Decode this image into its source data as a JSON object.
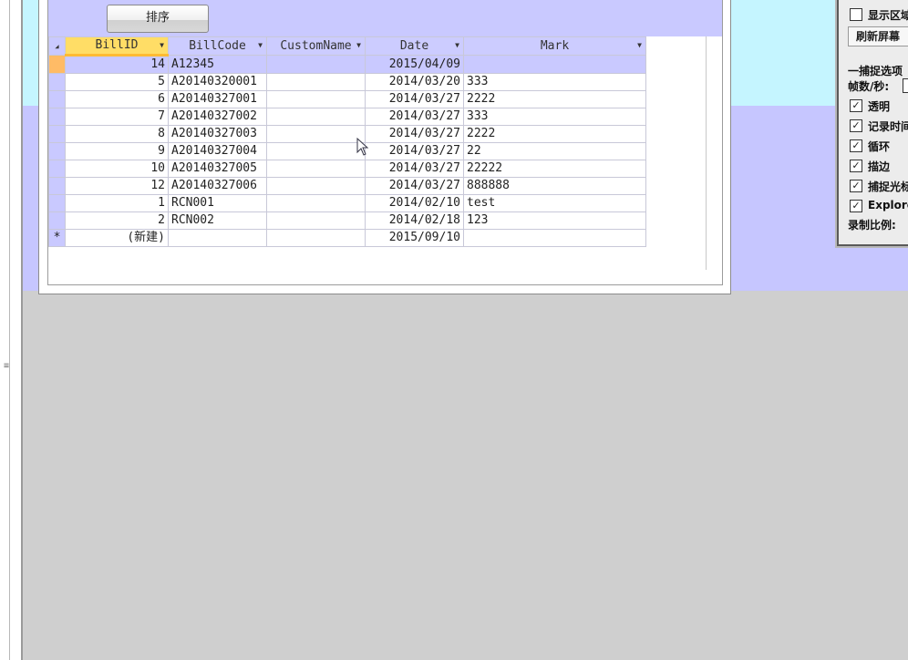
{
  "form": {
    "sort_button": "排序"
  },
  "grid": {
    "columns": [
      "BillID",
      "BillCode",
      "CustomName",
      "Date",
      "Mark"
    ],
    "rows": [
      {
        "BillID": "14",
        "BillCode": "A12345",
        "CustomName": "",
        "Date": "2015/04/09",
        "Mark": ""
      },
      {
        "BillID": "5",
        "BillCode": "A20140320001",
        "CustomName": "",
        "Date": "2014/03/20",
        "Mark": "333"
      },
      {
        "BillID": "6",
        "BillCode": "A20140327001",
        "CustomName": "",
        "Date": "2014/03/27",
        "Mark": "2222"
      },
      {
        "BillID": "7",
        "BillCode": "A20140327002",
        "CustomName": "",
        "Date": "2014/03/27",
        "Mark": "333"
      },
      {
        "BillID": "8",
        "BillCode": "A20140327003",
        "CustomName": "",
        "Date": "2014/03/27",
        "Mark": "2222"
      },
      {
        "BillID": "9",
        "BillCode": "A20140327004",
        "CustomName": "",
        "Date": "2014/03/27",
        "Mark": "22"
      },
      {
        "BillID": "10",
        "BillCode": "A20140327005",
        "CustomName": "",
        "Date": "2014/03/27",
        "Mark": "22222"
      },
      {
        "BillID": "12",
        "BillCode": "A20140327006",
        "CustomName": "",
        "Date": "2014/03/27",
        "Mark": "888888"
      },
      {
        "BillID": "1",
        "BillCode": "RCN001",
        "CustomName": "",
        "Date": "2014/02/10",
        "Mark": "test"
      },
      {
        "BillID": "2",
        "BillCode": "RCN002",
        "CustomName": "",
        "Date": "2014/02/18",
        "Mark": "123"
      }
    ],
    "new_row": {
      "marker": "*",
      "BillID": "(新建)",
      "Date": "2015/09/10"
    },
    "current_row_index": 0
  },
  "side_panel": {
    "show_region": "显示区域",
    "refresh_screen": "刷新屏幕",
    "capture_options": "一捕捉选项",
    "fps_label": "帧数/秒:",
    "checkboxes": [
      {
        "label": "透明",
        "checked": true
      },
      {
        "label": "记录时间",
        "checked": true
      },
      {
        "label": "循环",
        "checked": true
      },
      {
        "label": "描边",
        "checked": true
      },
      {
        "label": "捕捉光标",
        "checked": true
      },
      {
        "label": "Explorer",
        "checked": true
      }
    ],
    "record_ratio": "录制比例:"
  },
  "icons": {
    "check": "✓",
    "dropdown": "▾",
    "new_row_marker": "*"
  },
  "colors": {
    "header_band": "#c9c9ff",
    "selected_header": "#ffdd66",
    "background_cyan": "#c5f5ff",
    "background_lavender": "#c6c6ff"
  }
}
